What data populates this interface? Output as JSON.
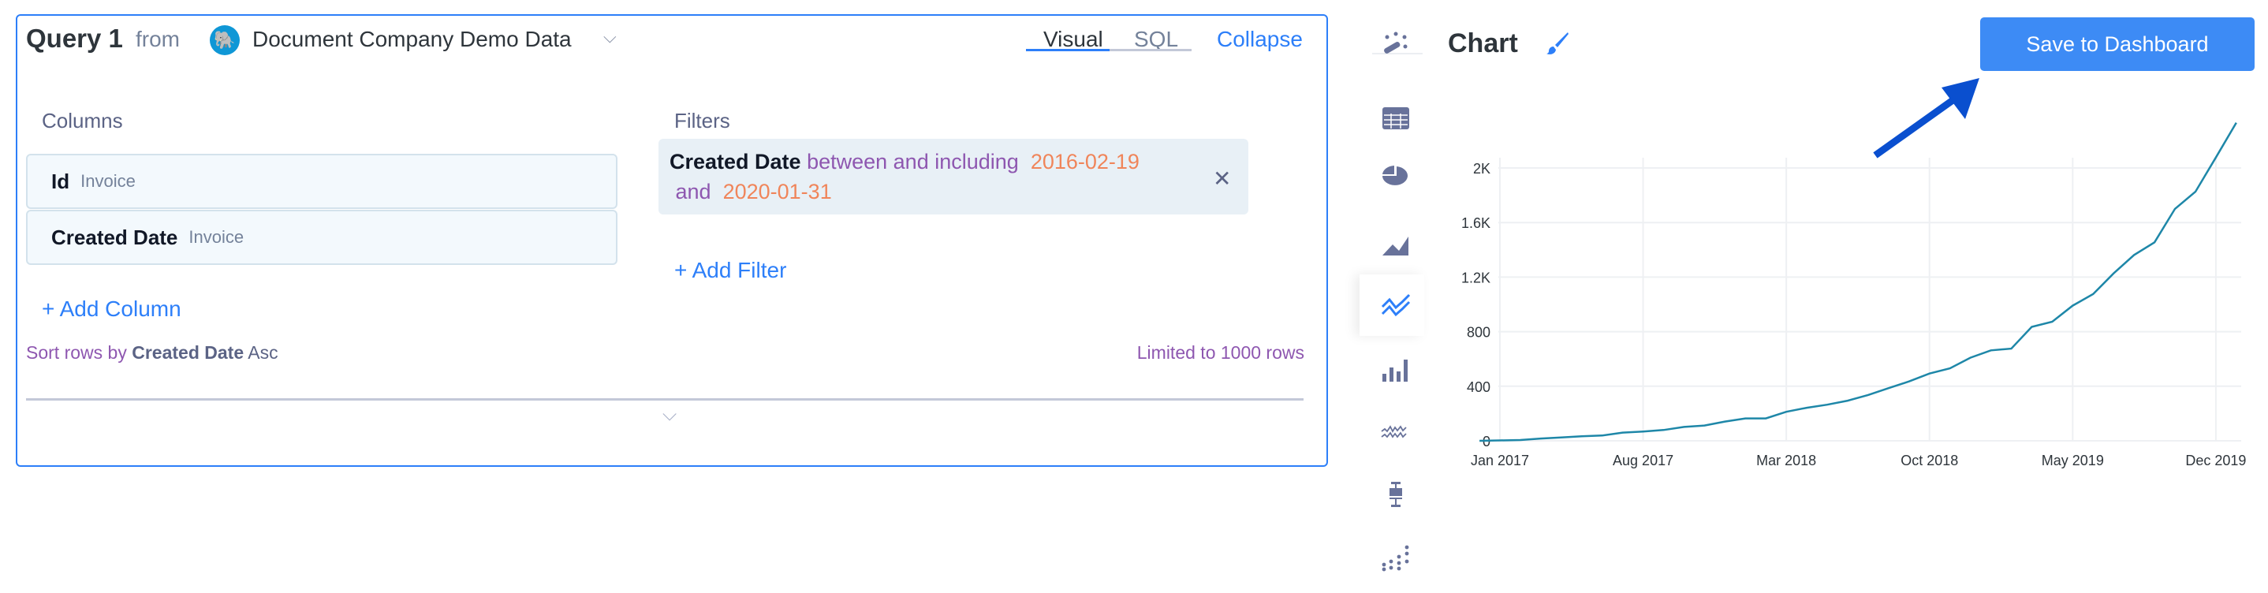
{
  "query": {
    "title": "Query 1",
    "from": "from",
    "database": "Document Company Demo Data",
    "tabs": [
      {
        "label": "Visual",
        "active": true
      },
      {
        "label": "SQL",
        "active": false
      }
    ],
    "collapse": "Collapse",
    "columns_label": "Columns",
    "columns": [
      {
        "name": "Id",
        "table": "Invoice"
      },
      {
        "name": "Created Date",
        "table": "Invoice"
      }
    ],
    "add_column": "+ Add Column",
    "filters_label": "Filters",
    "filter": {
      "field": "Created Date",
      "op": "between and including",
      "from": "2016-02-19",
      "and": "and",
      "to": "2020-01-31"
    },
    "add_filter": "+ Add Filter",
    "sort": {
      "prefix": "Sort rows by",
      "field": "Created Date",
      "dir": "Asc"
    },
    "limit": "Limited to 1000 rows"
  },
  "chart_types": [
    {
      "icon": "magic-wand-icon"
    },
    {
      "icon": "table-icon"
    },
    {
      "icon": "pie-chart-icon"
    },
    {
      "icon": "area-chart-icon"
    },
    {
      "icon": "line-chart-icon",
      "selected": true
    },
    {
      "icon": "bar-chart-icon"
    },
    {
      "icon": "spark-line-icon"
    },
    {
      "icon": "box-plot-icon"
    },
    {
      "icon": "scatter-icon"
    }
  ],
  "chart_panel": {
    "title": "Chart",
    "save": "Save to Dashboard",
    "accent": "#3d8bf5",
    "arrow_color": "#0a4fcf"
  },
  "chart_data": {
    "type": "line",
    "color": "#1e87a8",
    "grid": true,
    "x": [
      "Dec 2016",
      "Jan 2017",
      "Feb 2017",
      "Mar 2017",
      "Apr 2017",
      "May 2017",
      "Jun 2017",
      "Jul 2017",
      "Aug 2017",
      "Sep 2017",
      "Oct 2017",
      "Nov 2017",
      "Dec 2017",
      "Jan 2018",
      "Feb 2018",
      "Mar 2018",
      "Apr 2018",
      "May 2018",
      "Jun 2018",
      "Jul 2018",
      "Aug 2018",
      "Sep 2018",
      "Oct 2018",
      "Nov 2018",
      "Dec 2018",
      "Jan 2019",
      "Feb 2019",
      "Mar 2019",
      "Apr 2019",
      "May 2019",
      "Jun 2019",
      "Jul 2019",
      "Aug 2019",
      "Sep 2019",
      "Oct 2019",
      "Nov 2019",
      "Dec 2019",
      "Jan 2020"
    ],
    "values": [
      0,
      3,
      6,
      17,
      25,
      33,
      39,
      60,
      68,
      79,
      102,
      112,
      141,
      164,
      164,
      213,
      242,
      265,
      294,
      336,
      386,
      435,
      493,
      531,
      609,
      663,
      676,
      835,
      873,
      991,
      1076,
      1227,
      1362,
      1455,
      1700,
      1826,
      2077,
      2332
    ],
    "xticks": [
      "Jan 2017",
      "Aug 2017",
      "Mar 2018",
      "Oct 2018",
      "May 2019",
      "Dec 2019"
    ],
    "yticks": [
      {
        "v": 0,
        "label": "0"
      },
      {
        "v": 400,
        "label": "400"
      },
      {
        "v": 800,
        "label": "800"
      },
      {
        "v": 1200,
        "label": "1.2K"
      },
      {
        "v": 1600,
        "label": "1.6K"
      },
      {
        "v": 2000,
        "label": "2K"
      }
    ],
    "ylim": [
      0,
      2300
    ]
  }
}
